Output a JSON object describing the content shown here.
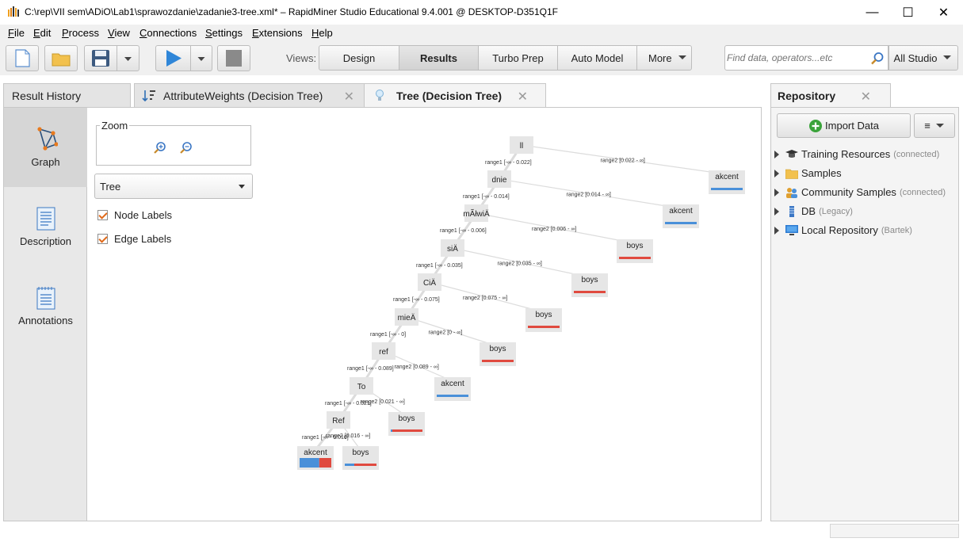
{
  "window": {
    "title": "C:\\rep\\VII sem\\ADiO\\Lab1\\sprawozdanie\\zadanie3-tree.xml* – RapidMiner Studio Educational 9.4.001 @ DESKTOP-D351Q1F",
    "minimize": "—",
    "maximize": "☐",
    "close": "✕"
  },
  "menu": [
    "File",
    "Edit",
    "Process",
    "View",
    "Connections",
    "Settings",
    "Extensions",
    "Help"
  ],
  "toolbar": {
    "views_label": "Views:",
    "views": [
      "Design",
      "Results",
      "Turbo Prep",
      "Auto Model",
      "More"
    ],
    "active_view": "Results",
    "search_placeholder": "Find data, operators...etc",
    "scope": "All Studio"
  },
  "tabs": {
    "history": "Result History",
    "weights": "AttributeWeights (Decision Tree)",
    "tree": "Tree (Decision Tree)"
  },
  "side_tabs": [
    "Graph",
    "Description",
    "Annotations"
  ],
  "controls": {
    "zoom_label": "Zoom",
    "layout_select": "Tree",
    "node_labels": "Node Labels",
    "edge_labels": "Edge Labels"
  },
  "tree": {
    "colors": {
      "akcent": "#4a90d9",
      "boys": "#e04a3f",
      "edge": "#dcdcdc"
    },
    "chain": [
      "ll",
      "dnie",
      "mÃłwiÄ",
      "siÄ",
      "CiÄ",
      "mieÄ",
      "ref",
      "To",
      "Ref"
    ],
    "edges_left": [
      "range1 [-∞ - 0.022]",
      "range1 [-∞ - 0.014]",
      "range1 [-∞ - 0.006]",
      "range1 [-∞ - 0.035]",
      "range1 [-∞ - 0.075]",
      "range1 [-∞ - 0]",
      "range1 [-∞ - 0.089]",
      "range1 [-∞ - 0.021]",
      "range1 [-∞ - 0.016]"
    ],
    "edges_right": [
      "range2 [0.022 - ∞]",
      "range2 [0.014 - ∞]",
      "range2 [0.006 - ∞]",
      "range2 [0.035 - ∞]",
      "range2 [0.075 - ∞]",
      "range2 [0 - ∞]",
      "range2 [0.089 - ∞]",
      "range2 [0.021 - ∞]",
      "range2 [0.016 - ∞]"
    ],
    "leaves_right": [
      {
        "label": "akcent",
        "akcent": 1.0,
        "boys": 0.0
      },
      {
        "label": "akcent",
        "akcent": 1.0,
        "boys": 0.0
      },
      {
        "label": "boys",
        "akcent": 0.0,
        "boys": 1.0
      },
      {
        "label": "boys",
        "akcent": 0.0,
        "boys": 1.0
      },
      {
        "label": "boys",
        "akcent": 0.0,
        "boys": 1.0
      },
      {
        "label": "boys",
        "akcent": 0.0,
        "boys": 1.0
      },
      {
        "label": "akcent",
        "akcent": 1.0,
        "boys": 0.0
      },
      {
        "label": "boys",
        "akcent": 0.05,
        "boys": 0.95
      },
      {
        "label": "boys",
        "akcent": 0.3,
        "boys": 0.7
      }
    ],
    "final_leaf": {
      "label": "akcent",
      "akcent": 0.62,
      "boys": 0.38
    }
  },
  "repository": {
    "title": "Repository",
    "import_label": "Import Data",
    "menu_label": "≡",
    "items": [
      {
        "label": "Training Resources",
        "sub": "(connected)",
        "icon": "graduation-cap-icon"
      },
      {
        "label": "Samples",
        "sub": "",
        "icon": "folder-icon"
      },
      {
        "label": "Community Samples",
        "sub": "(connected)",
        "icon": "community-icon"
      },
      {
        "label": "DB",
        "sub": "(Legacy)",
        "icon": "database-icon"
      },
      {
        "label": "Local Repository",
        "sub": "(Bartek)",
        "icon": "computer-icon"
      }
    ]
  }
}
